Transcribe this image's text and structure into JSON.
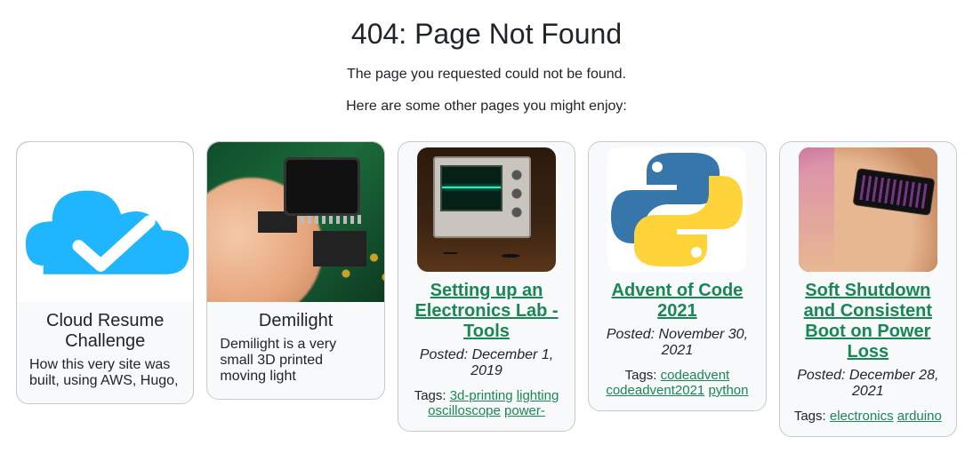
{
  "header": {
    "title": "404: Page Not Found",
    "subtitle": "The page you requested could not be found.",
    "hint": "Here are some other pages you might enjoy:"
  },
  "cards": [
    {
      "title": "Cloud Resume Challenge",
      "desc": "How this very site was built, using AWS, Hugo,"
    },
    {
      "title": "Demilight",
      "desc": "Demilight is a very small 3D printed moving light"
    },
    {
      "title": "Setting up an Electronics Lab - Tools",
      "posted": "Posted: December 1, 2019",
      "tags_label": "Tags: ",
      "tags": [
        "3d-printing",
        "lighting",
        "oscilloscope",
        "power-"
      ]
    },
    {
      "title": "Advent of Code 2021",
      "posted": "Posted: November 30, 2021",
      "tags_label": "Tags: ",
      "tags": [
        "codeadvent",
        "codeadvent2021",
        "python"
      ]
    },
    {
      "title": "Soft Shutdown and Consistent Boot on Power Loss",
      "posted": "Posted: December 28, 2021",
      "tags_label": "Tags: ",
      "tags": [
        "electronics",
        "arduino"
      ]
    }
  ]
}
